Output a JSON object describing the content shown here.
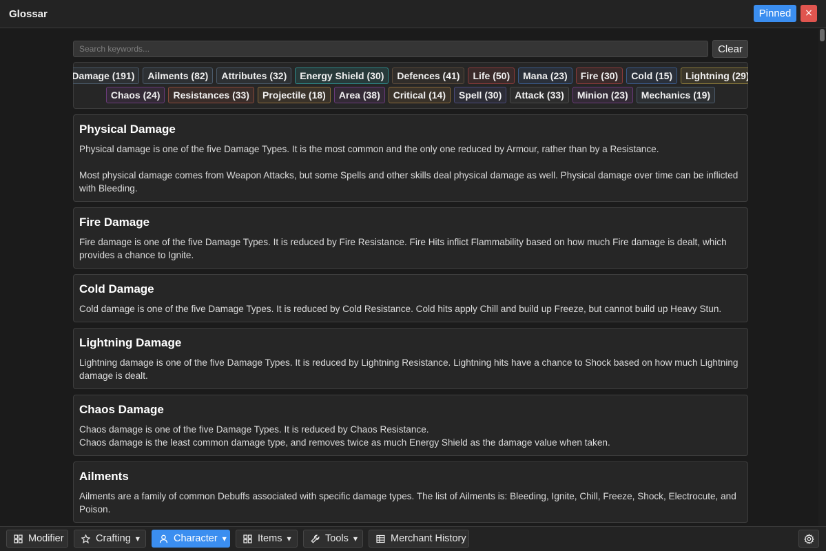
{
  "window": {
    "title": "Glossar",
    "pinned_label": "Pinned",
    "close_label": "×"
  },
  "search": {
    "placeholder": "Search keywords...",
    "value": "",
    "clear_label": "Clear"
  },
  "tags": [
    {
      "label": "Damage (191)",
      "color": "#4a5a6a"
    },
    {
      "label": "Ailments (82)",
      "color": "#4a5a6a"
    },
    {
      "label": "Attributes (32)",
      "color": "#4a5a6a"
    },
    {
      "label": "Energy Shield (30)",
      "color": "#2e8a8a"
    },
    {
      "label": "Defences (41)",
      "color": "#5a4a3a"
    },
    {
      "label": "Life (50)",
      "color": "#8a3a3a"
    },
    {
      "label": "Mana (23)",
      "color": "#3a5a8a"
    },
    {
      "label": "Fire (30)",
      "color": "#8a3a3a"
    },
    {
      "label": "Cold (15)",
      "color": "#3a5a8a"
    },
    {
      "label": "Lightning (29)",
      "color": "#8a7a3a"
    },
    {
      "label": "Chaos (24)",
      "color": "#6a3a7a"
    },
    {
      "label": "Resistances (33)",
      "color": "#8a4a3a"
    },
    {
      "label": "Projectile (18)",
      "color": "#8a6a3a"
    },
    {
      "label": "Area (38)",
      "color": "#6a3a7a"
    },
    {
      "label": "Critical (14)",
      "color": "#8a6a3a"
    },
    {
      "label": "Spell (30)",
      "color": "#4a4a7a"
    },
    {
      "label": "Attack (33)",
      "color": "#4a4a4a"
    },
    {
      "label": "Minion (23)",
      "color": "#6a3a7a"
    },
    {
      "label": "Mechanics (19)",
      "color": "#4a5a6a"
    }
  ],
  "entries": [
    {
      "title": "Physical Damage",
      "text": "Physical damage is one of the five Damage Types. It is the most common and the only one reduced by Armour, rather than by a Resistance.\n\nMost physical damage comes from Weapon Attacks, but some Spells and other skills deal physical damage as well. Physical damage over time can be inflicted with Bleeding."
    },
    {
      "title": "Fire Damage",
      "text": "Fire damage is one of the five Damage Types. It is reduced by Fire Resistance. Fire Hits inflict Flammability based on how much Fire damage is dealt, which provides a chance to Ignite."
    },
    {
      "title": "Cold Damage",
      "text": "Cold damage is one of the five Damage Types. It is reduced by Cold Resistance. Cold hits apply Chill and build up Freeze, but cannot build up Heavy Stun."
    },
    {
      "title": "Lightning Damage",
      "text": "Lightning damage is one of the five Damage Types. It is reduced by Lightning Resistance. Lightning hits have a chance to Shock based on how much Lightning damage is dealt."
    },
    {
      "title": "Chaos Damage",
      "text": "Chaos damage is one of the five Damage Types. It is reduced by Chaos Resistance.\nChaos damage is the least common damage type, and removes twice as much Energy Shield as the damage value when taken."
    },
    {
      "title": "Ailments",
      "text": "Ailments are a family of common Debuffs associated with specific damage types. The list of Ailments is: Bleeding, Ignite, Chill, Freeze, Shock, Electrocute, and Poison."
    },
    {
      "title": "",
      "text": ""
    }
  ],
  "nav": {
    "modifier": "Modifier",
    "crafting": "Crafting",
    "character": "Character",
    "items": "Items",
    "tools": "Tools",
    "merchant_history": "Merchant History",
    "caret": "▼",
    "active": "Character",
    "accent": "#3b8ef0"
  }
}
